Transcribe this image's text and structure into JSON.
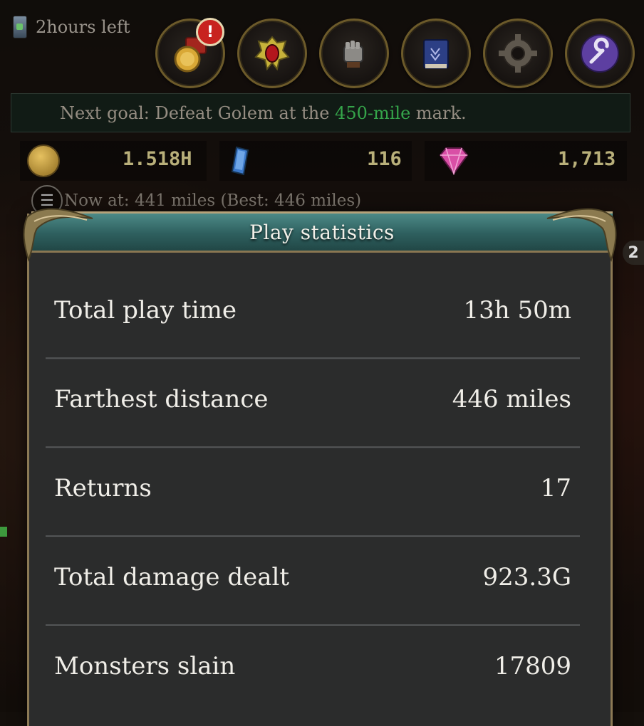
{
  "timer": {
    "text": "2hours left",
    "icon": "scroll-icon"
  },
  "top_icons": [
    {
      "name": "coins-chest-icon",
      "badge": "!"
    },
    {
      "name": "amulet-icon"
    },
    {
      "name": "gauntlet-icon"
    },
    {
      "name": "book-icon"
    },
    {
      "name": "gear-icon"
    },
    {
      "name": "wrench-icon"
    }
  ],
  "goal": {
    "prefix": "Next goal: Defeat Golem at the ",
    "highlight": "450-mile",
    "suffix": " mark.",
    "highlight_color": "#35a54a"
  },
  "currencies": {
    "gold": "1.518H",
    "crystal": "116",
    "gem": "1,713"
  },
  "distance": {
    "text": "Now at: 441 miles (Best: 446 miles)"
  },
  "side_badge": "2",
  "panel": {
    "title": "Play statistics",
    "rows": [
      {
        "label": "Total play time",
        "value": "13h 50m"
      },
      {
        "label": "Farthest distance",
        "value": "446 miles"
      },
      {
        "label": "Returns",
        "value": "17"
      },
      {
        "label": "Total damage dealt",
        "value": "923.3G"
      },
      {
        "label": "Monsters slain",
        "value": "17809"
      }
    ]
  },
  "colors": {
    "panel_bg": "#2b2c2c",
    "header_teal": "#2e5f5e",
    "frame_gold": "#b5a27a",
    "currency_text": "#b9b07a"
  }
}
